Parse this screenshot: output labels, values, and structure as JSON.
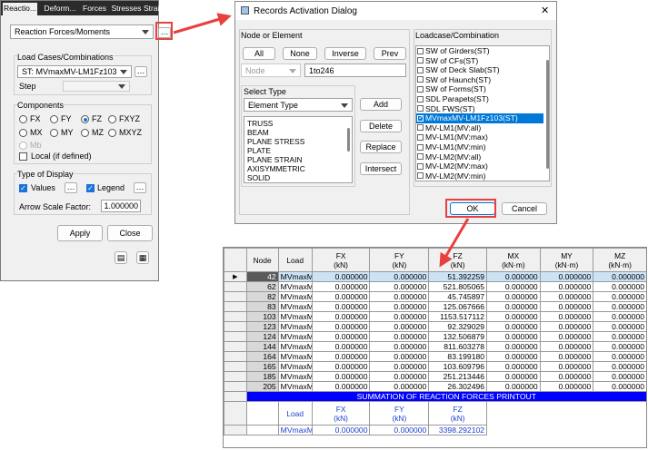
{
  "left_panel": {
    "tabs": [
      "Reactio...",
      "Deform...",
      "Forces",
      "Stresses",
      "Strains"
    ],
    "result_type": "Reaction Forces/Moments",
    "load_cases_label": "Load Cases/Combinations",
    "load_case_value": "ST: MVmaxMV-LM1Fz103",
    "step_label": "Step",
    "components_label": "Components",
    "components": [
      {
        "label": "FX",
        "checked": false,
        "enabled": true
      },
      {
        "label": "FY",
        "checked": false,
        "enabled": true
      },
      {
        "label": "FZ",
        "checked": true,
        "enabled": true
      },
      {
        "label": "FXYZ",
        "checked": false,
        "enabled": true
      },
      {
        "label": "MX",
        "checked": false,
        "enabled": true
      },
      {
        "label": "MY",
        "checked": false,
        "enabled": true
      },
      {
        "label": "MZ",
        "checked": false,
        "enabled": true
      },
      {
        "label": "MXYZ",
        "checked": false,
        "enabled": true
      },
      {
        "label": "Mb",
        "checked": false,
        "enabled": false
      }
    ],
    "local_label": "Local (if defined)",
    "type_of_display_label": "Type of Display",
    "values_label": "Values",
    "legend_label": "Legend",
    "arrow_scale_label": "Arrow Scale Factor:",
    "arrow_scale_value": "1.000000",
    "apply_label": "Apply",
    "close_label": "Close"
  },
  "dialog": {
    "title": "Records Activation Dialog",
    "close_glyph": "✕",
    "node_or_element_label": "Node or Element",
    "all_label": "All",
    "none_label": "None",
    "inverse_label": "Inverse",
    "prev_label": "Prev",
    "node_combo": "Node",
    "node_range": "1to246",
    "select_type_label": "Select Type",
    "select_type_value": "Element Type",
    "add_label": "Add",
    "delete_label": "Delete",
    "replace_label": "Replace",
    "intersect_label": "Intersect",
    "element_types": [
      "TRUSS",
      "BEAM",
      "PLANE STRESS",
      "PLATE",
      "PLANE STRAIN",
      "AXISYMMETRIC",
      "SOLID"
    ],
    "loadcase_label": "Loadcase/Combination",
    "loadcases": [
      {
        "label": "SW of Girders(ST)",
        "checked": false
      },
      {
        "label": "SW of CFs(ST)",
        "checked": false
      },
      {
        "label": "SW of Deck Slab(ST)",
        "checked": false
      },
      {
        "label": "SW of Haunch(ST)",
        "checked": false
      },
      {
        "label": "SW of Forms(ST)",
        "checked": false
      },
      {
        "label": "SDL Parapets(ST)",
        "checked": false
      },
      {
        "label": "SDL FWS(ST)",
        "checked": false
      },
      {
        "label": "MVmaxMV-LM1Fz103(ST)",
        "checked": true
      },
      {
        "label": "MV-LM1(MV:all)",
        "checked": false
      },
      {
        "label": "MV-LM1(MV:max)",
        "checked": false
      },
      {
        "label": "MV-LM1(MV:min)",
        "checked": false
      },
      {
        "label": "MV-LM2(MV:all)",
        "checked": false
      },
      {
        "label": "MV-LM2(MV:max)",
        "checked": false
      },
      {
        "label": "MV-LM2(MV:min)",
        "checked": false
      }
    ],
    "ok_label": "OK",
    "cancel_label": "Cancel"
  },
  "table": {
    "headers": [
      {
        "l1": "Node",
        "l2": ""
      },
      {
        "l1": "Load",
        "l2": ""
      },
      {
        "l1": "FX",
        "l2": "(kN)"
      },
      {
        "l1": "FY",
        "l2": "(kN)"
      },
      {
        "l1": "FZ",
        "l2": "(kN)"
      },
      {
        "l1": "MX",
        "l2": "(kN·m)"
      },
      {
        "l1": "MY",
        "l2": "(kN·m)"
      },
      {
        "l1": "MZ",
        "l2": "(kN·m)"
      }
    ],
    "rows": [
      {
        "node": "42",
        "load": "MVmaxM",
        "fx": "0.000000",
        "fy": "0.000000",
        "fz": "51.392259",
        "mx": "0.000000",
        "my": "0.000000",
        "mz": "0.000000"
      },
      {
        "node": "62",
        "load": "MVmaxM",
        "fx": "0.000000",
        "fy": "0.000000",
        "fz": "521.805065",
        "mx": "0.000000",
        "my": "0.000000",
        "mz": "0.000000"
      },
      {
        "node": "82",
        "load": "MVmaxM",
        "fx": "0.000000",
        "fy": "0.000000",
        "fz": "45.745897",
        "mx": "0.000000",
        "my": "0.000000",
        "mz": "0.000000"
      },
      {
        "node": "83",
        "load": "MVmaxM",
        "fx": "0.000000",
        "fy": "0.000000",
        "fz": "125.067666",
        "mx": "0.000000",
        "my": "0.000000",
        "mz": "0.000000"
      },
      {
        "node": "103",
        "load": "MVmaxM",
        "fx": "0.000000",
        "fy": "0.000000",
        "fz": "1153.517112",
        "mx": "0.000000",
        "my": "0.000000",
        "mz": "0.000000"
      },
      {
        "node": "123",
        "load": "MVmaxM",
        "fx": "0.000000",
        "fy": "0.000000",
        "fz": "92.329029",
        "mx": "0.000000",
        "my": "0.000000",
        "mz": "0.000000"
      },
      {
        "node": "124",
        "load": "MVmaxM",
        "fx": "0.000000",
        "fy": "0.000000",
        "fz": "132.506879",
        "mx": "0.000000",
        "my": "0.000000",
        "mz": "0.000000"
      },
      {
        "node": "144",
        "load": "MVmaxM",
        "fx": "0.000000",
        "fy": "0.000000",
        "fz": "811.603278",
        "mx": "0.000000",
        "my": "0.000000",
        "mz": "0.000000"
      },
      {
        "node": "164",
        "load": "MVmaxM",
        "fx": "0.000000",
        "fy": "0.000000",
        "fz": "83.199180",
        "mx": "0.000000",
        "my": "0.000000",
        "mz": "0.000000"
      },
      {
        "node": "165",
        "load": "MVmaxM",
        "fx": "0.000000",
        "fy": "0.000000",
        "fz": "103.609796",
        "mx": "0.000000",
        "my": "0.000000",
        "mz": "0.000000"
      },
      {
        "node": "185",
        "load": "MVmaxM",
        "fx": "0.000000",
        "fy": "0.000000",
        "fz": "251.213446",
        "mx": "0.000000",
        "my": "0.000000",
        "mz": "0.000000"
      },
      {
        "node": "205",
        "load": "MVmaxM",
        "fx": "0.000000",
        "fy": "0.000000",
        "fz": "26.302496",
        "mx": "0.000000",
        "my": "0.000000",
        "mz": "0.000000"
      }
    ],
    "summation_title": "SUMMATION OF REACTION FORCES PRINTOUT",
    "summation_headers": [
      {
        "l1": "Load",
        "l2": ""
      },
      {
        "l1": "FX",
        "l2": "(kN)"
      },
      {
        "l1": "FY",
        "l2": "(kN)"
      },
      {
        "l1": "FZ",
        "l2": "(kN)"
      }
    ],
    "summation_row": {
      "load": "MVmaxM",
      "fx": "0.000000",
      "fy": "0.000000",
      "fz": "3398.292102"
    }
  },
  "colors": {
    "annotation_red": "#e8403f",
    "selection_blue": "#0078d7",
    "summation_bar": "#0000ff"
  }
}
